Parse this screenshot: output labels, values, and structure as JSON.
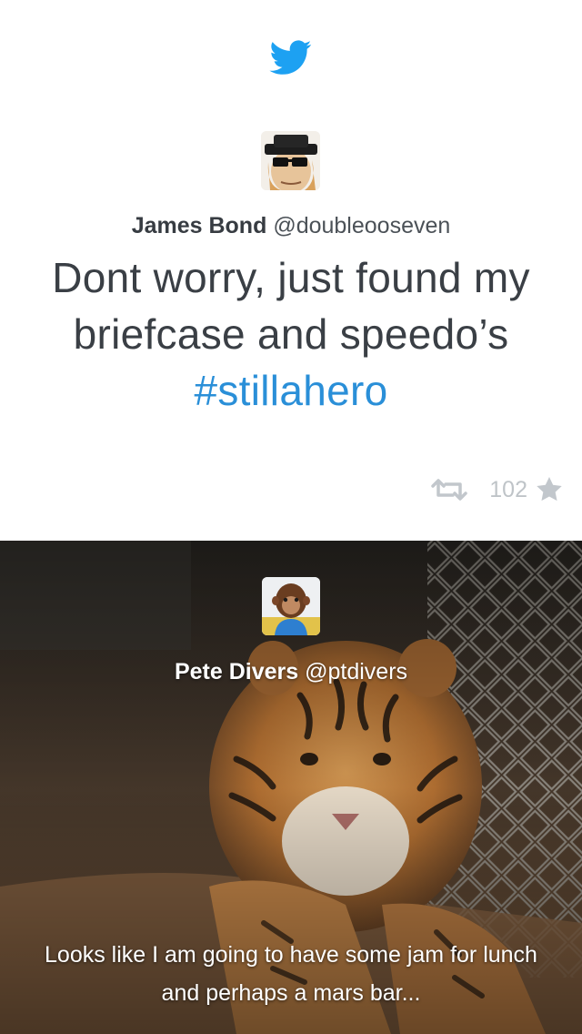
{
  "app": {
    "logo_icon": "twitter-bird-icon",
    "accent_color": "#1da1f2"
  },
  "tweets": [
    {
      "author_name": "James Bond",
      "author_handle": "@doubleooseven",
      "text": "Dont worry, just found my briefcase and speedo’s",
      "hashtag": "#stillahero",
      "retweet_icon": "retweet-icon",
      "count": "102",
      "favorite_icon": "star-icon"
    },
    {
      "author_name": "Pete Divers",
      "author_handle": "@ptdivers",
      "text": "Looks like I am going to have some jam for lunch and perhaps a mars bar..."
    }
  ]
}
